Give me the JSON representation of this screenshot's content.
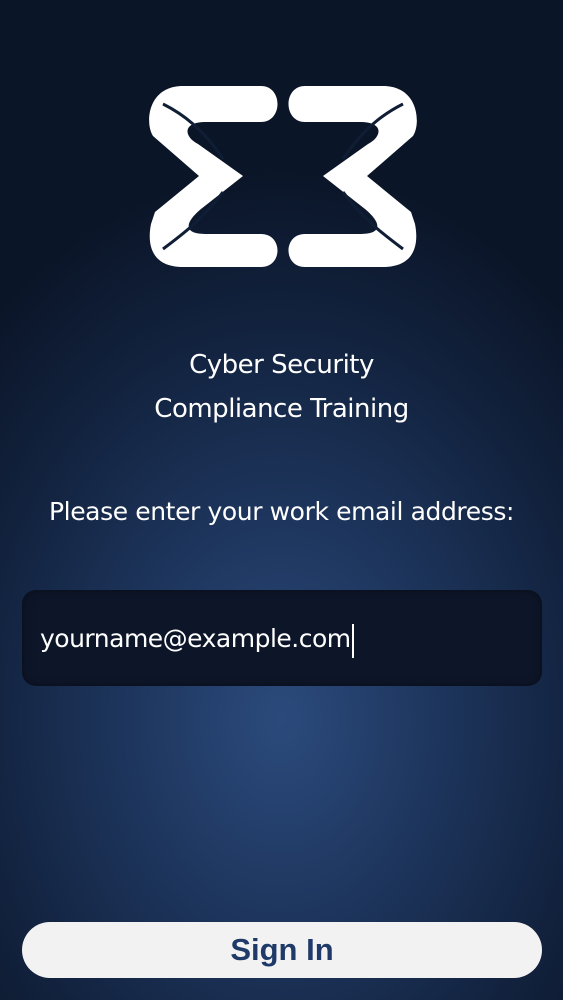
{
  "app": {
    "title_line_1": "Cyber Security",
    "title_line_2": "Compliance Training",
    "logo_icon": "ribbon-sigma-logo-icon"
  },
  "login": {
    "prompt": "Please enter your work email address:",
    "email_value": "yourname@example.com",
    "sign_in_label": "Sign In"
  },
  "colors": {
    "background_top": "#0b1528",
    "background_center": "#2b4a7c",
    "input_background": "#0d1629",
    "button_background": "#f2f2f2",
    "button_text": "#1f3a68"
  }
}
